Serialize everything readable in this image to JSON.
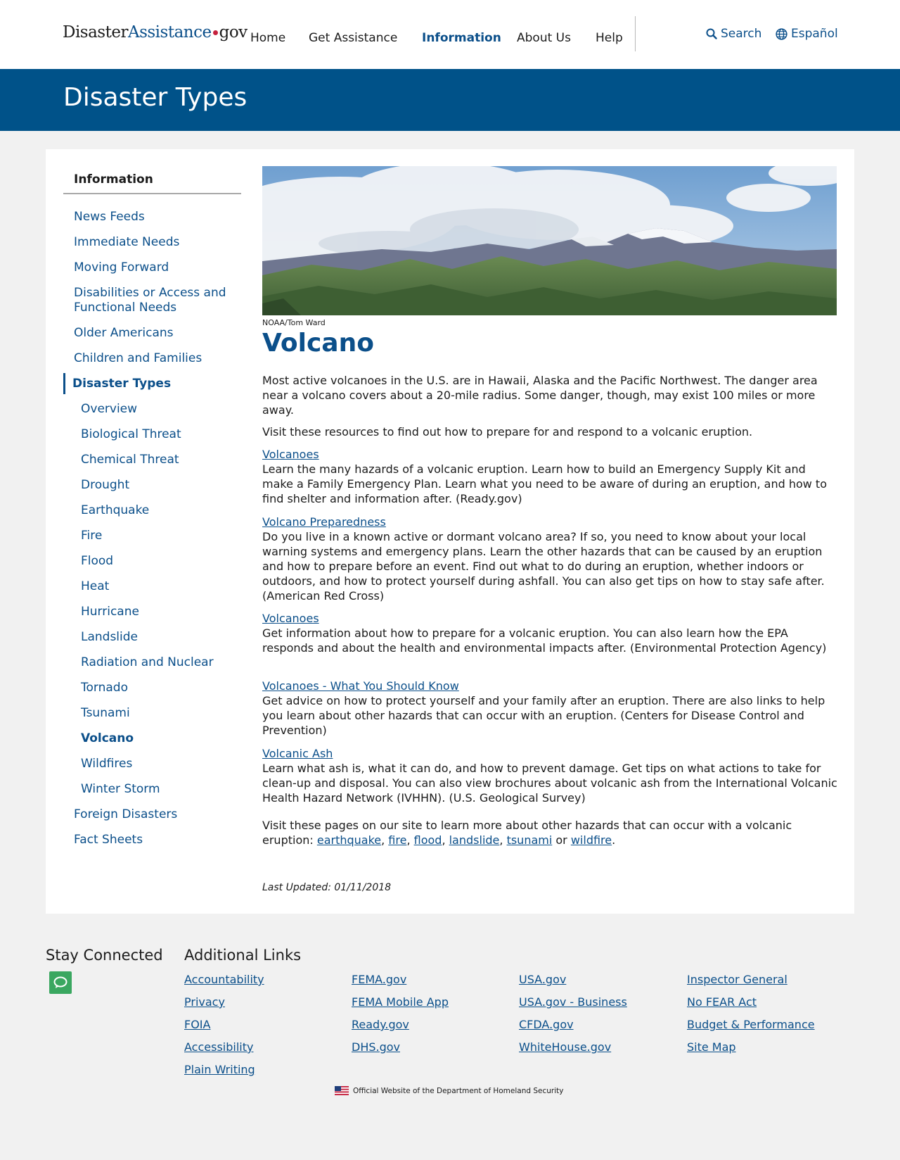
{
  "header": {
    "logo_disaster": "Disaster",
    "logo_assistance": "Assistance",
    "logo_gov": "gov",
    "nav": [
      {
        "label": "Home"
      },
      {
        "label": "Get Assistance"
      },
      {
        "label": "Information"
      },
      {
        "label": "About Us"
      },
      {
        "label": "Help"
      }
    ],
    "search_label": "Search",
    "language_label": "Español"
  },
  "banner": {
    "title": "Disaster Types"
  },
  "sidebar": {
    "heading": "Information",
    "items": [
      {
        "label": "News Feeds"
      },
      {
        "label": "Immediate Needs"
      },
      {
        "label": "Moving Forward"
      },
      {
        "label": "Disabilities or Access and Functional Needs"
      },
      {
        "label": "Older Americans"
      },
      {
        "label": "Children and Families"
      },
      {
        "label": "Disaster Types"
      },
      {
        "label": "Foreign Disasters"
      },
      {
        "label": "Fact Sheets"
      }
    ],
    "sub_items": [
      {
        "label": "Overview"
      },
      {
        "label": "Biological Threat"
      },
      {
        "label": "Chemical Threat"
      },
      {
        "label": "Drought"
      },
      {
        "label": "Earthquake"
      },
      {
        "label": "Fire"
      },
      {
        "label": "Flood"
      },
      {
        "label": "Heat"
      },
      {
        "label": "Hurricane"
      },
      {
        "label": "Landslide"
      },
      {
        "label": "Radiation and Nuclear"
      },
      {
        "label": "Tornado"
      },
      {
        "label": "Tsunami"
      },
      {
        "label": "Volcano"
      },
      {
        "label": "Wildfires"
      },
      {
        "label": "Winter Storm"
      }
    ]
  },
  "content": {
    "image_credit": "NOAA/Tom Ward",
    "title": "Volcano",
    "intro": "Most active volcanoes in the U.S. are in Hawaii, Alaska and the Pacific Northwest. The danger area near a volcano covers about a 20-mile radius. Some danger, though, may exist 100 miles or more away.",
    "intro2": "Visit these resources to find out how to prepare for and respond to a volcanic eruption.",
    "resources": [
      {
        "link": "Volcanoes",
        "text": "Learn the many hazards of a volcanic eruption. Learn how to build an Emergency Supply Kit and make a Family Emergency Plan. Learn what you need to be aware of during an eruption, and how to find shelter and information after. (Ready.gov)"
      },
      {
        "link": "Volcano Preparedness",
        "text": "Do you live in a known active or dormant volcano area? If so, you need to know about your local warning systems and emergency plans. Learn the other hazards that can be caused by an eruption and how to prepare before an event. Find out what to do during an eruption, whether indoors or outdoors, and how to protect yourself during ashfall. You can also get tips on how to stay safe after. (American Red Cross)"
      },
      {
        "link": "Volcanoes",
        "text": "Get information about how to prepare for a volcanic eruption. You can also learn how the EPA responds and about the health and environmental impacts after. (Environmental Protection Agency)"
      },
      {
        "link": "Volcanoes - What You Should Know",
        "text": "Get advice on how to protect yourself and your family after an eruption. There are also links to help you learn about other hazards that can occur with an eruption. (Centers for Disease Control and Prevention)"
      },
      {
        "link": "Volcanic Ash",
        "text": "Learn what ash is, what it can do, and how to prevent damage. Get tips on what actions to take for clean-up and disposal. You can also view brochures about volcanic ash from the International Volcanic Health Hazard Network (IVHHN). (U.S. Geological Survey)"
      }
    ],
    "outro_prefix": "Visit these pages on our site to learn more about other hazards that can occur with a volcanic eruption: ",
    "outro_links": {
      "earthquake": "earthquake",
      "fire": "fire",
      "flood": "flood",
      "landslide": "landslide",
      "tsunami": "tsunami",
      "wildfire": "wildfire"
    },
    "outro_comma": ", ",
    "outro_or": " or ",
    "outro_end": ".",
    "last_updated": "Last Updated: 01/11/2018"
  },
  "footer": {
    "stay_connected": "Stay Connected",
    "additional_links": "Additional Links",
    "links": [
      [
        "Accountability",
        "Privacy",
        "FOIA",
        "Accessibility",
        "Plain Writing"
      ],
      [
        "FEMA.gov",
        "FEMA Mobile App",
        "Ready.gov",
        "DHS.gov"
      ],
      [
        "USA.gov",
        "USA.gov - Business",
        "CFDA.gov",
        "WhiteHouse.gov"
      ],
      [
        "Inspector General",
        "No FEAR Act",
        "Budget & Performance",
        "Site Map"
      ]
    ],
    "official": "Official Website of the Department of Homeland Security"
  },
  "colors": {
    "brand_blue": "#005289",
    "link_blue": "#0b4f8a",
    "chat_green": "#3aa760"
  },
  "icons": [
    "search-icon",
    "globe-icon",
    "chat-icon",
    "us-flag-icon"
  ]
}
